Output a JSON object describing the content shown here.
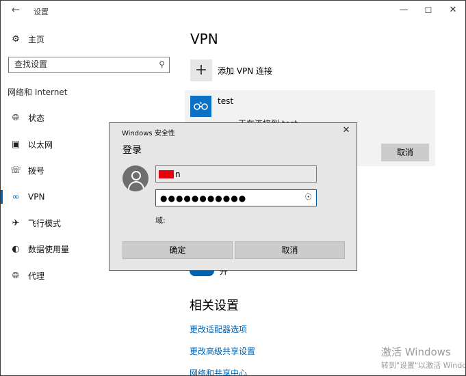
{
  "window": {
    "title": "设置",
    "back_icon": "back-arrow-icon"
  },
  "sidebar": {
    "home_label": "主页",
    "search_placeholder": "查找设置",
    "section": "网络和 Internet",
    "items": [
      {
        "label": "状态",
        "icon": "globe-icon"
      },
      {
        "label": "以太网",
        "icon": "ethernet-icon"
      },
      {
        "label": "拨号",
        "icon": "dialup-icon"
      },
      {
        "label": "VPN",
        "icon": "vpn-icon",
        "active": true
      },
      {
        "label": "飞行模式",
        "icon": "airplane-icon"
      },
      {
        "label": "数据使用量",
        "icon": "data-usage-icon"
      },
      {
        "label": "代理",
        "icon": "proxy-globe-icon"
      }
    ]
  },
  "main": {
    "heading": "VPN",
    "add_vpn_label": "添加 VPN 连接",
    "connection": {
      "name": "test",
      "status": "正在连接到 test",
      "cancel_label": "取消"
    },
    "toggle_label": "开",
    "related_heading": "相关设置",
    "related_links": [
      "更改适配器选项",
      "更改高级共享设置",
      "网络和共享中心"
    ]
  },
  "dialog": {
    "title": "Windows 安全性",
    "heading": "登录",
    "username_suffix": "n",
    "password_value": "●●●●●●●●●●●",
    "domain_label": "域:",
    "ok_label": "确定",
    "cancel_label": "取消"
  },
  "watermark": {
    "line1": "激活 Windows",
    "line2": "转到\"设置\"以激活 Windows。"
  },
  "colors": {
    "accent": "#0063b1",
    "vpn_icon_bg": "#0a71c6",
    "redaction": "#e8000d"
  }
}
